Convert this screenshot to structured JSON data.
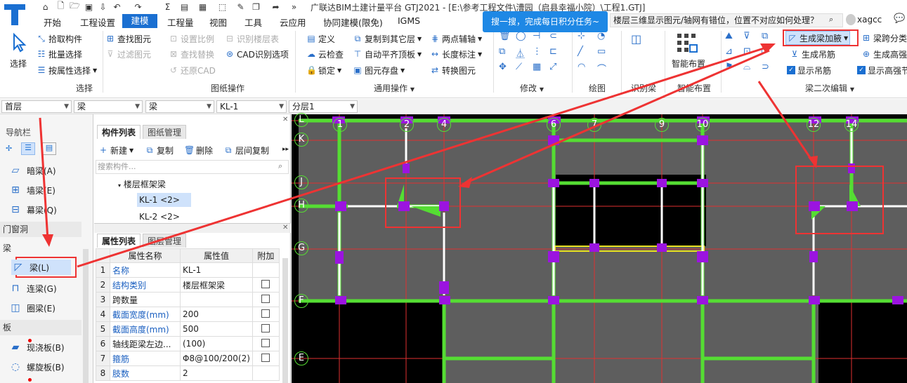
{
  "app": {
    "title": "广联达BIM土建计量平台 GTJ2021 - [E:\\参考工程文件\\漕园（启县幸福小院）\\工程1.GTJ]",
    "user": "xagcc"
  },
  "menu": [
    "开始",
    "工程设置",
    "建模",
    "工程量",
    "视图",
    "工具",
    "云应用",
    "协同建模(限免)",
    "IGMS"
  ],
  "tooltip": "搜一搜，完成每日积分任务~",
  "search_text": "楼层三维显示图元/轴网有错位，位置不对应如何处理？",
  "ribbon": {
    "select": {
      "big": "选择",
      "items": [
        "拾取构件",
        "批量选择",
        "按属性选择"
      ],
      "group": "选择"
    },
    "drawing": {
      "items": [
        "查找图元",
        "过滤图元",
        "设置比例",
        "识别楼层表",
        "查找替换",
        "CAD识别选项",
        "还原CAD"
      ],
      "group": "图纸操作"
    },
    "common": {
      "items": [
        "定义",
        "复制到其它层",
        "两点辅轴",
        "云检查",
        "自动平齐顶板",
        "长度标注",
        "锁定",
        "图元存盘",
        "转换图元"
      ],
      "group": "通用操作"
    },
    "modify": {
      "group": "修改"
    },
    "draw": {
      "group": "绘图"
    },
    "identify": {
      "group": "识别梁"
    },
    "smart": {
      "big": "智能布置",
      "group": "智能布置"
    },
    "beam2": {
      "items": [
        "生成梁加腋",
        "梁跨分类",
        "生成吊筋",
        "生成高强节点",
        "显示吊筋",
        "显示高强节点"
      ],
      "group": "梁二次编辑"
    }
  },
  "toolbar2": [
    "首层",
    "梁",
    "梁",
    "KL-1",
    "分层1"
  ],
  "nav": {
    "title": "导航栏",
    "items_top": [
      "暗梁(A)",
      "墙梁(E)",
      "幕梁(Q)"
    ],
    "sec_door": "门窗洞",
    "sec_beam": "梁",
    "beam_items": [
      "梁(L)",
      "连梁(G)",
      "圈梁(E)"
    ],
    "sec_slab": "板",
    "slab_items": [
      "现浇板(B)",
      "螺旋板(B)"
    ]
  },
  "component_panel": {
    "tabs": [
      "构件列表",
      "图纸管理"
    ],
    "actions": [
      "新建",
      "复制",
      "删除",
      "层间复制"
    ],
    "search_placeholder": "搜索构件...",
    "tree_group": "楼层框架梁",
    "items": [
      "KL-1 <2>",
      "KL-2 <2>"
    ]
  },
  "property_panel": {
    "tabs": [
      "属性列表",
      "图层管理"
    ],
    "headers": [
      "属性名称",
      "属性值",
      "附加"
    ],
    "rows": [
      {
        "no": "1",
        "name": "名称",
        "value": "KL-1",
        "blue": true,
        "cb": false
      },
      {
        "no": "2",
        "name": "结构类别",
        "value": "楼层框架梁",
        "blue": true,
        "cb": true
      },
      {
        "no": "3",
        "name": "跨数量",
        "value": "",
        "blue": false,
        "cb": true
      },
      {
        "no": "4",
        "name": "截面宽度(mm)",
        "value": "200",
        "blue": true,
        "cb": true
      },
      {
        "no": "5",
        "name": "截面高度(mm)",
        "value": "500",
        "blue": true,
        "cb": true
      },
      {
        "no": "6",
        "name": "轴线距梁左边...",
        "value": "(100)",
        "blue": false,
        "cb": true
      },
      {
        "no": "7",
        "name": "箍筋",
        "value": "Φ8@100/200(2)",
        "blue": true,
        "cb": true
      },
      {
        "no": "8",
        "name": "肢数",
        "value": "2",
        "blue": true,
        "cb": false
      }
    ]
  },
  "canvas": {
    "axis_x": [
      "1",
      "2",
      "4",
      "6",
      "7",
      "9",
      "10",
      "12",
      "14"
    ],
    "axis_y": [
      "L",
      "K",
      "J",
      "H",
      "G",
      "F",
      "E"
    ]
  },
  "colors": {
    "accent": "#1a6fd1",
    "annotation": "#ee3333",
    "beam": "#55dd33",
    "column": "#9b14e0",
    "slab": "#5a5a5a"
  }
}
